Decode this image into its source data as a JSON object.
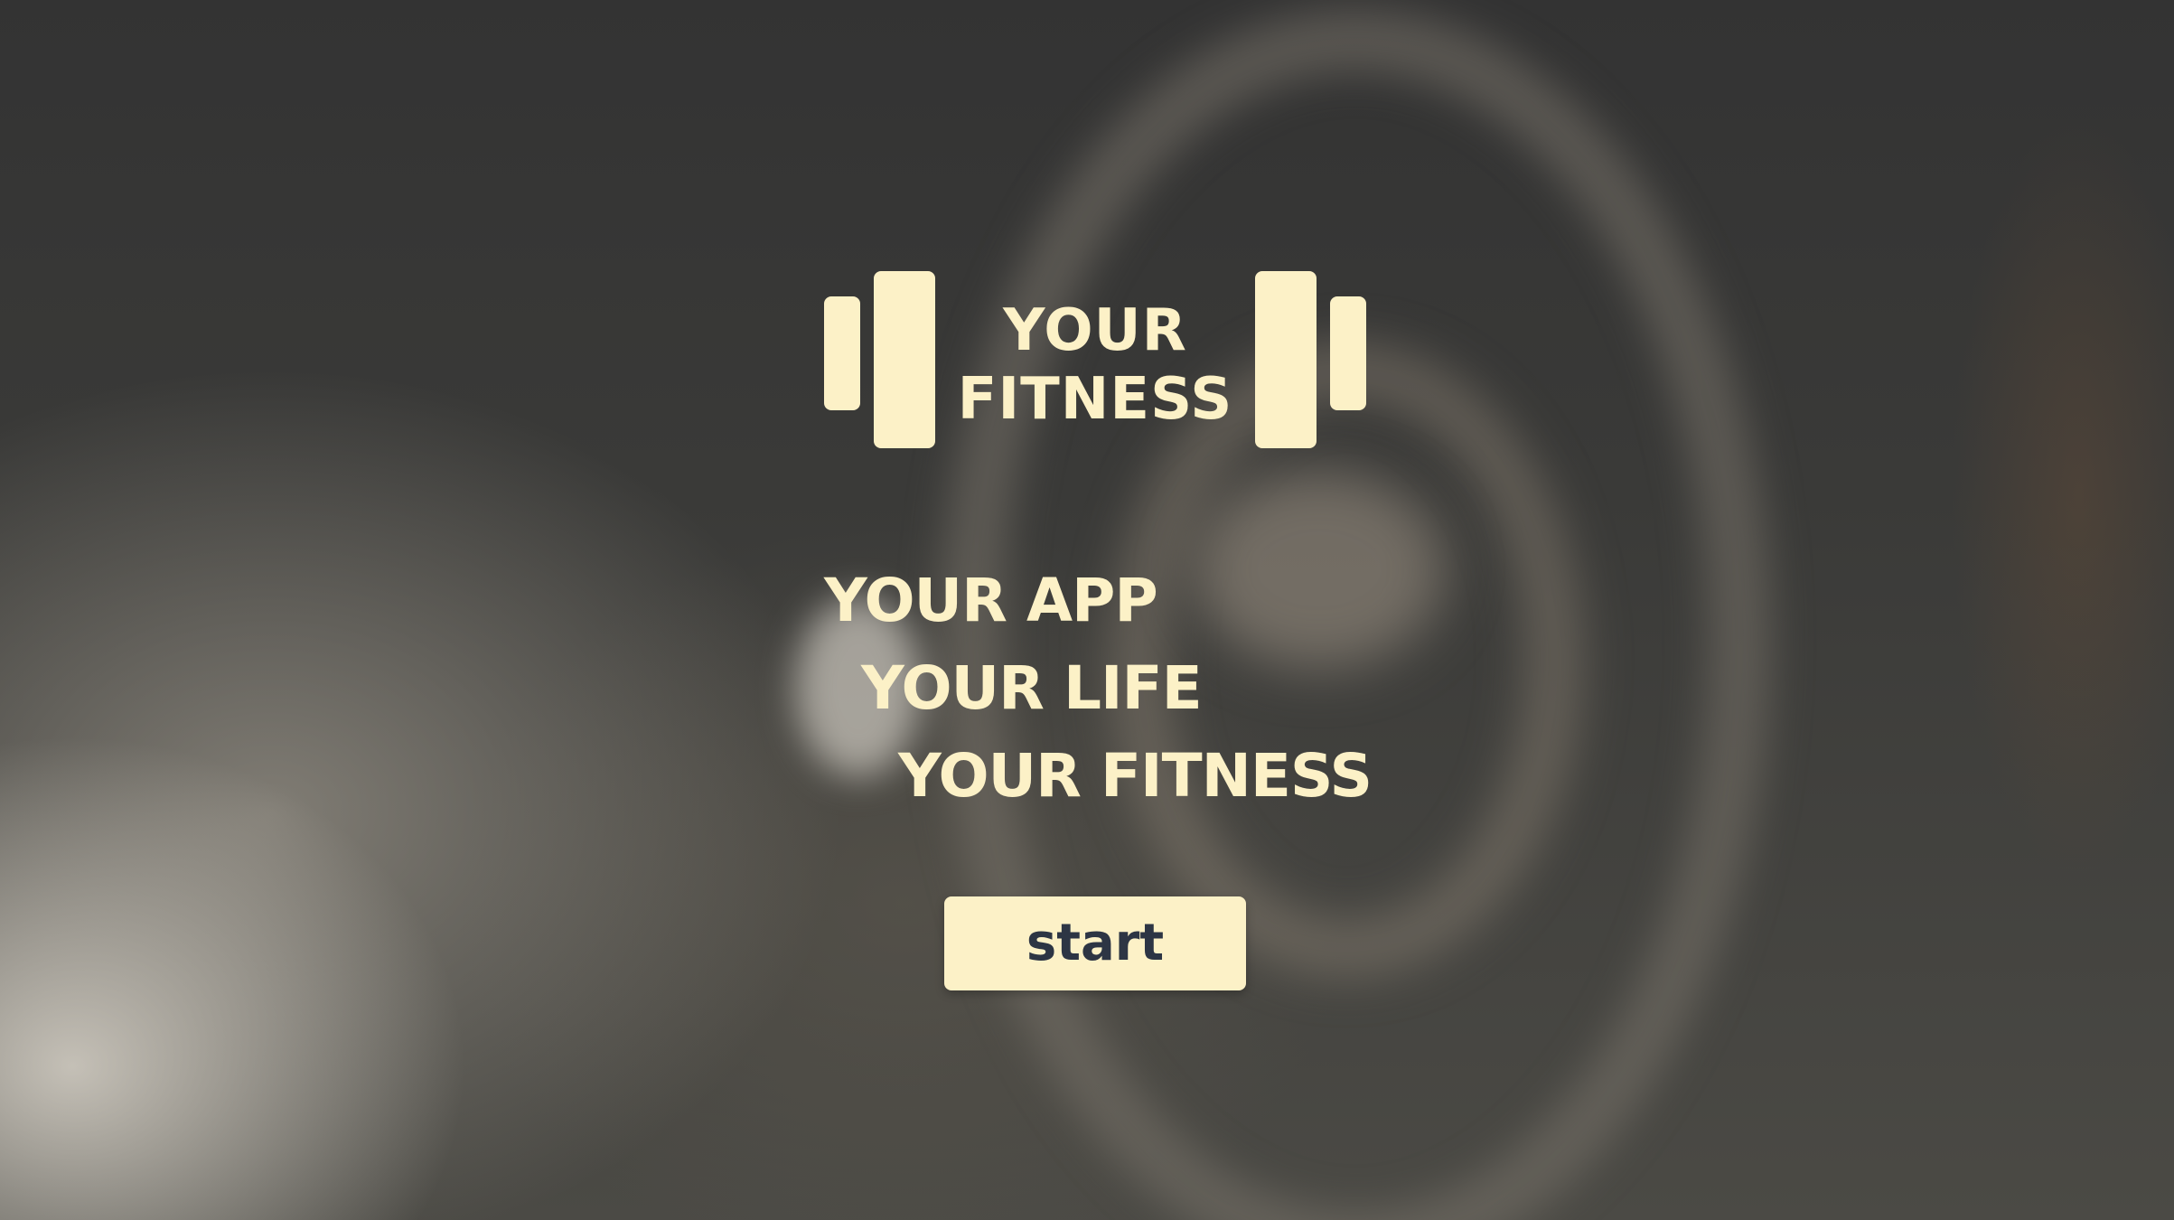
{
  "logo": {
    "line1": "YOUR",
    "line2": "FITNESS",
    "icon": "dumbbell-icon"
  },
  "tagline": {
    "line1": "YOUR APP",
    "line2": "YOUR LIFE",
    "line3": "YOUR FITNESS"
  },
  "actions": {
    "start_label": "start"
  },
  "colors": {
    "accent": "#fcf1c7",
    "button_text": "#2d3544",
    "background": "#2f2f2f"
  }
}
